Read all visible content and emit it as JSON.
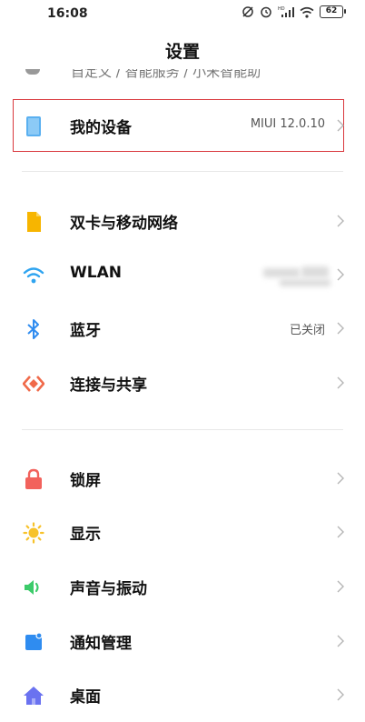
{
  "status_bar": {
    "time": "16:08",
    "battery": "62",
    "icons": [
      "alarm-off-icon",
      "alarm-clock-icon",
      "hd-signal-icon",
      "wifi-icon",
      "battery-icon"
    ]
  },
  "page_title": "设置",
  "cut_off_item": {
    "label": "自定义 / 智能服务 / 小米智能助理"
  },
  "my_device": {
    "label": "我的设备",
    "value": "MIUI 12.0.10",
    "icon": "tablet-icon",
    "icon_color": "#5ab0f0"
  },
  "network_section": [
    {
      "label": "双卡与移动网络",
      "value": "",
      "icon": "sim-card-icon",
      "icon_color": "#f7b500"
    },
    {
      "label": "WLAN",
      "value": "",
      "icon": "wifi-icon",
      "icon_color": "#2fa4f0"
    },
    {
      "label": "蓝牙",
      "value": "已关闭",
      "icon": "bluetooth-icon",
      "icon_color": "#2f8cf0"
    },
    {
      "label": "连接与共享",
      "value": "",
      "icon": "share-connect-icon",
      "icon_color": "#f06a4a"
    }
  ],
  "general_section": [
    {
      "label": "锁屏",
      "icon": "lock-icon",
      "icon_color": "#f2625c"
    },
    {
      "label": "显示",
      "icon": "sun-icon",
      "icon_color": "#f7c22a"
    },
    {
      "label": "声音与振动",
      "icon": "speaker-icon",
      "icon_color": "#3ccb6a"
    },
    {
      "label": "通知管理",
      "icon": "notification-icon",
      "icon_color": "#2f8cf0"
    },
    {
      "label": "桌面",
      "icon": "home-icon",
      "icon_color": "#6a72f0"
    }
  ],
  "colors": {
    "highlight_border": "#d9383d",
    "chevron": "#b5b5b5"
  }
}
